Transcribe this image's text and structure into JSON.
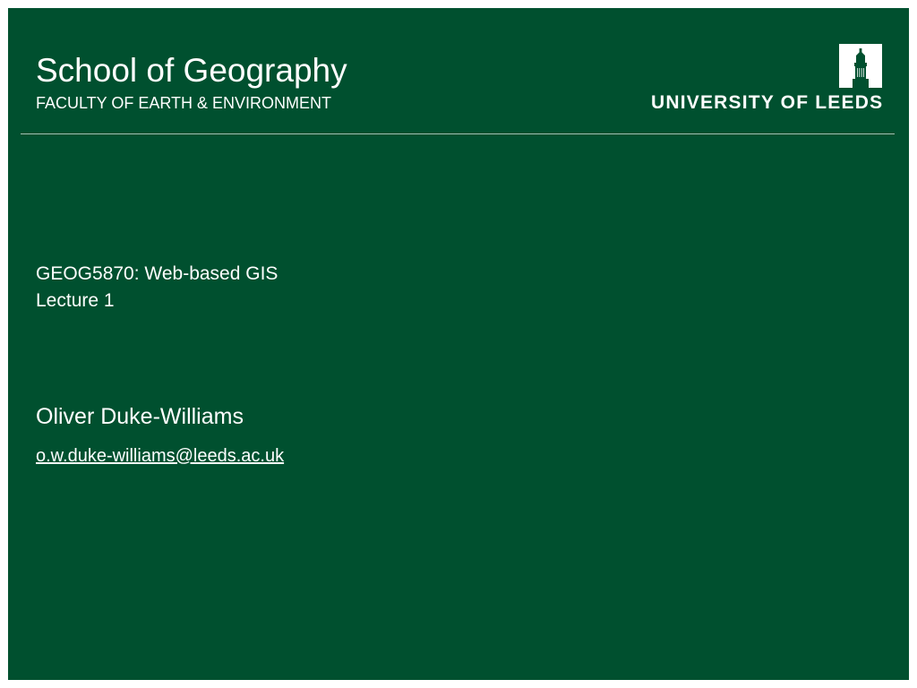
{
  "header": {
    "school_title": "School of Geography",
    "faculty": "FACULTY OF EARTH & ENVIRONMENT",
    "logo": {
      "icon": "parkinson-tower-icon",
      "text": "UNIVERSITY OF LEEDS"
    }
  },
  "course": {
    "code_title": "GEOG5870: Web-based GIS",
    "lecture": "Lecture 1"
  },
  "presenter": {
    "name": "Oliver Duke-Williams",
    "email": "o.w.duke-williams@leeds.ac.uk",
    "email_href": "mailto:o.w.duke-williams@leeds.ac.uk"
  },
  "colors": {
    "background": "#00502f",
    "text": "#ffffff",
    "divider": "#a9bfb1"
  }
}
